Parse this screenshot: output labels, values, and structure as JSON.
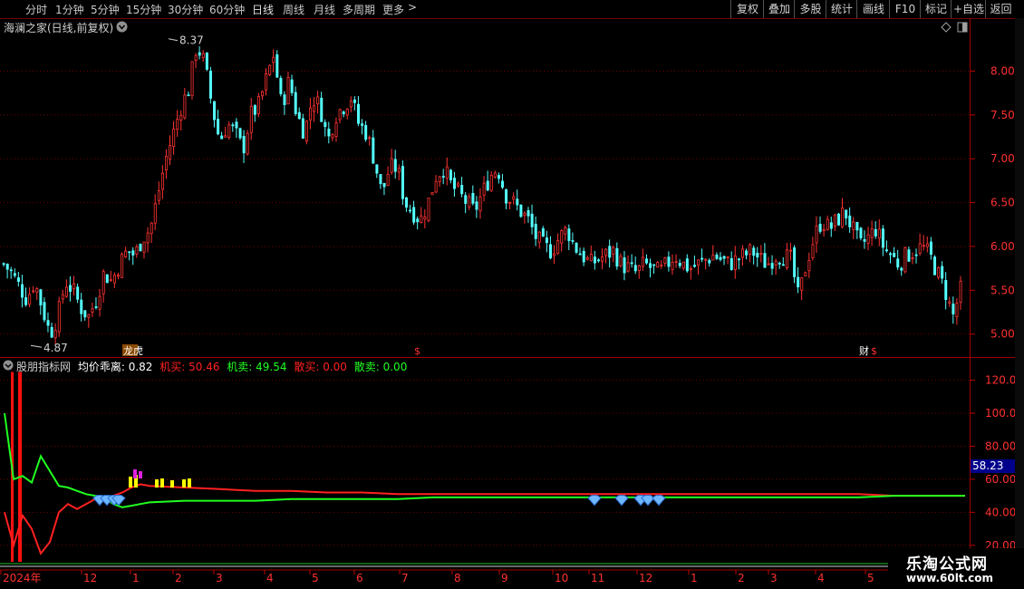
{
  "toolbar": {
    "periods": [
      {
        "label": "分时",
        "active": false
      },
      {
        "label": "1分钟",
        "active": false
      },
      {
        "label": "5分钟",
        "active": false
      },
      {
        "label": "15分钟",
        "active": false
      },
      {
        "label": "30分钟",
        "active": false
      },
      {
        "label": "60分钟",
        "active": false
      },
      {
        "label": "日线",
        "active": true
      },
      {
        "label": "周线",
        "active": false
      },
      {
        "label": "月线",
        "active": false
      },
      {
        "label": "多周期",
        "active": false
      },
      {
        "label": "更多",
        "active": false
      }
    ],
    "more_chevron": ">",
    "buttons": [
      "复权",
      "叠加",
      "多股",
      "统计",
      "画线",
      "F10",
      "标记",
      "+自选",
      "返回"
    ]
  },
  "main_chart": {
    "title": "海澜之家(日线,前复权)",
    "y_ticks": [
      "8.00",
      "7.50",
      "7.00",
      "6.50",
      "6.00",
      "5.50",
      "5.00"
    ],
    "high_label": "8.37",
    "low_label": "4.87",
    "markers": [
      {
        "text": "龙虎",
        "color": "#ffffff"
      },
      {
        "text": "$",
        "color": "#ff3030"
      },
      {
        "text": "财",
        "color": "#ffffff"
      },
      {
        "text": "$",
        "color": "#ff3030"
      }
    ]
  },
  "chart_data": [
    {
      "type": "candlestick",
      "title": "海澜之家(日线,前复权)",
      "y_range": [
        4.8,
        8.45
      ],
      "high": 8.37,
      "low": 4.87,
      "close_path": [
        5.8,
        5.7,
        5.55,
        5.4,
        5.6,
        5.3,
        5.0,
        5.2,
        5.6,
        5.5,
        5.3,
        5.2,
        5.4,
        5.7,
        5.6,
        5.8,
        5.95,
        5.9,
        6.1,
        6.2,
        6.6,
        7.0,
        7.3,
        7.6,
        7.8,
        8.3,
        8.1,
        7.6,
        7.2,
        7.4,
        7.3,
        7.1,
        7.5,
        7.6,
        7.9,
        8.2,
        7.6,
        7.9,
        7.5,
        7.3,
        7.7,
        7.6,
        7.2,
        7.5,
        7.6,
        7.7,
        7.4,
        7.3,
        7.0,
        6.6,
        6.9,
        6.9,
        6.5,
        6.4,
        6.3,
        6.5,
        6.8,
        6.9,
        6.7,
        6.6,
        6.5,
        6.4,
        6.6,
        6.8,
        6.9,
        6.6,
        6.5,
        6.4,
        6.3,
        6.1,
        6.0,
        5.95,
        6.1,
        6.2,
        6.0,
        5.9,
        5.8,
        5.85,
        5.9,
        5.95,
        5.8,
        5.75,
        5.7,
        5.8,
        5.75,
        5.7,
        5.8,
        5.9,
        5.8,
        5.75,
        5.8,
        5.85,
        5.9,
        5.85,
        5.8,
        5.85,
        5.9,
        5.95,
        5.85,
        5.8,
        5.9,
        5.9,
        5.85,
        5.4,
        5.8,
        6.1,
        6.3,
        6.2,
        6.3,
        6.4,
        6.2,
        6.0,
        6.1,
        6.2,
        6.0,
        5.9,
        5.8,
        5.9,
        5.95,
        6.0,
        5.9,
        5.7,
        5.5,
        5.2,
        5.5
      ],
      "x_labels": [
        "2024年",
        "12",
        "1",
        "2",
        "3",
        "4",
        "5",
        "6",
        "7",
        "8",
        "9",
        "10",
        "11",
        "12",
        "1",
        "2",
        "3",
        "4",
        "5"
      ]
    },
    {
      "type": "line",
      "title": "股朋指标网",
      "y_ticks": [
        "120.0",
        "100.0",
        "80.00",
        "60.00",
        "40.00",
        "20.00"
      ],
      "y_range": [
        10,
        128
      ],
      "current_value_box": "58.23",
      "series": [
        {
          "name": "机买",
          "color": "#ff2020",
          "values": [
            40,
            20,
            38,
            30,
            15,
            22,
            40,
            45,
            42,
            45,
            48,
            47,
            50,
            52,
            55,
            57,
            56,
            55,
            54,
            53,
            53,
            52,
            52,
            51,
            51,
            51,
            51,
            51,
            51,
            51,
            51,
            51,
            51,
            51,
            51,
            51,
            51,
            50,
            50,
            50
          ]
        },
        {
          "name": "机卖",
          "color": "#20ff20",
          "values": [
            100,
            60,
            62,
            58,
            74,
            65,
            56,
            55,
            53,
            51,
            50,
            49,
            45,
            43,
            44,
            45,
            46,
            47,
            47,
            47,
            48,
            48,
            48,
            48,
            49,
            49,
            49,
            49,
            49,
            49,
            49,
            49,
            49,
            49,
            49,
            49,
            49,
            50,
            50,
            50
          ]
        }
      ],
      "legend": [
        {
          "label": "均价乖离: 0.82",
          "color": "#ffffff"
        },
        {
          "label": "机买: 50.46",
          "color": "#ff2020"
        },
        {
          "label": "机卖: 49.54",
          "color": "#20ff20"
        },
        {
          "label": "散买: 0.00",
          "color": "#ff2020"
        },
        {
          "label": "散卖: 0.00",
          "color": "#20ff20"
        }
      ]
    }
  ],
  "watermark": {
    "name": "乐淘公式网",
    "url": "www.60lt.com"
  }
}
